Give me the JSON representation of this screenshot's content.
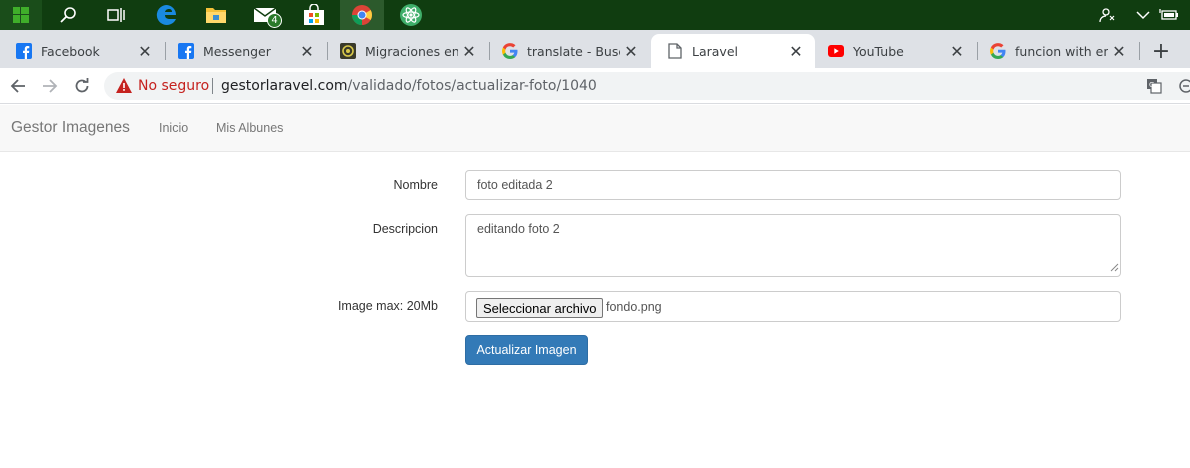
{
  "taskbar": {
    "icons": [
      "windows-start-icon",
      "search-icon",
      "task-view-icon",
      "edge-icon",
      "file-explorer-icon",
      "mail-icon",
      "store-icon",
      "chrome-icon",
      "atom-icon"
    ],
    "mail_badge": "4",
    "tray_icons": [
      "people-icon",
      "chevron-up-icon",
      "battery-icon"
    ],
    "colors": {
      "background": "#103d10",
      "active": "#2c5a2c"
    }
  },
  "browser": {
    "tabs": [
      {
        "label": "Facebook",
        "icon": "facebook-icon"
      },
      {
        "label": "Messenger",
        "icon": "facebook-icon"
      },
      {
        "label": "Migraciones en Laravel",
        "icon": "site-icon"
      },
      {
        "label": "translate - Buscar con Google",
        "icon": "google-icon"
      },
      {
        "label": "Laravel",
        "icon": "page-icon",
        "active": true
      },
      {
        "label": "YouTube",
        "icon": "youtube-icon"
      },
      {
        "label": "funcion with en laravel",
        "icon": "google-icon"
      }
    ],
    "new_tab": "+",
    "security_text": "No seguro",
    "url_host": "gestorlaravel.com",
    "url_path": "/validado/fotos/actualizar-foto/1040"
  },
  "app": {
    "brand": "Gestor Imagenes",
    "nav": [
      "Inicio",
      "Mis Albunes"
    ]
  },
  "form": {
    "nombre_label": "Nombre",
    "nombre_value": "foto editada 2",
    "descripcion_label": "Descripcion",
    "descripcion_value": "editando foto 2",
    "image_label": "Image max: 20Mb",
    "file_button": "Seleccionar archivo",
    "file_name": "fondo.png",
    "submit": "Actualizar Imagen",
    "submit_color": "#337ab7"
  }
}
